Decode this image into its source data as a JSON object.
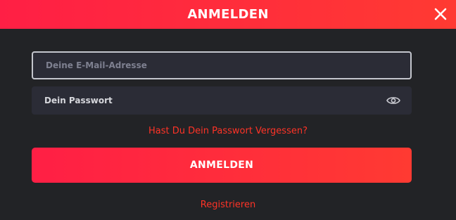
{
  "header": {
    "title": "ANMELDEN",
    "close_icon": "close-icon"
  },
  "form": {
    "email": {
      "value": "",
      "placeholder": "Deine E-Mail-Adresse"
    },
    "password": {
      "value": "",
      "placeholder": "Dein Passwort",
      "toggle_icon": "eye-icon"
    },
    "forgot_password_label": "Hast Du Dein Passwort Vergessen?",
    "submit_label": "ANMELDEN",
    "register_label": "Registrieren"
  },
  "colors": {
    "accent_start": "#ff1f45",
    "accent_end": "#ff3a32",
    "link": "#ff3326",
    "background": "#222326",
    "field_background": "#2b2c36"
  }
}
